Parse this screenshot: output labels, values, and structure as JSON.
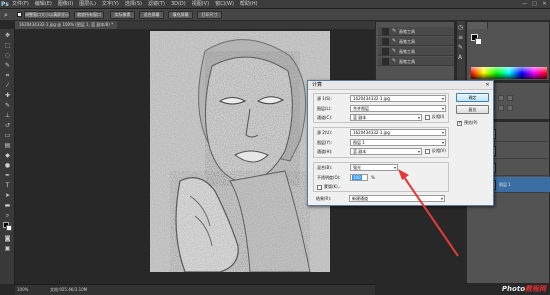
{
  "app": {
    "logo": "Ps"
  },
  "menu": [
    "文件(F)",
    "编辑(E)",
    "图像(I)",
    "图层(L)",
    "文字(Y)",
    "选择(S)",
    "滤镜(T)",
    "3D(D)",
    "视图(V)",
    "窗口(W)",
    "帮助(H)"
  ],
  "window_controls": [
    "—",
    "□",
    "✕"
  ],
  "options": {
    "buttons": [
      "调整窗口大小以满屏显示",
      "缩放所有窗口",
      "实际像素",
      "适合屏幕",
      "填充屏幕",
      "打印尺寸"
    ]
  },
  "document": {
    "tab": "1620434332-1.jpg @ 100% (图层 1, 蓝 副本/8) *",
    "zoom": "100%",
    "doc_info": "文档:925.4K/3.10M"
  },
  "history": {
    "items": [
      "画笔工具",
      "画笔工具",
      "画笔工具",
      "画笔工具"
    ]
  },
  "layers": {
    "items": [
      "图层 1",
      "",
      "",
      ""
    ]
  },
  "dialog": {
    "title": "计算",
    "source1": {
      "source_label": "源 1(S):",
      "source_value": "1620434332-1.jpg",
      "layer_label": "图层(L):",
      "layer_value": "合并图层",
      "channel_label": "通道(C):",
      "channel_value": "蓝 副本",
      "invert_label": "反相(I)"
    },
    "source2": {
      "source_label": "源 2(U):",
      "source_value": "1620434332-1.jpg",
      "layer_label": "图层(Y):",
      "layer_value": "图层 1",
      "channel_label": "通道(H):",
      "channel_value": "蓝 副本",
      "invert_label": "反相(V)"
    },
    "blend": {
      "blend_label": "混合(B):",
      "blend_value": "强光",
      "opacity_label": "不透明度(O):",
      "opacity_value": "100",
      "opacity_unit": "%",
      "mask_label": "蒙版(K)..."
    },
    "result": {
      "result_label": "结果(R):",
      "result_value": "新建通道"
    },
    "ok_label": "确定",
    "reset_label": "复位",
    "preview_label": "预览(P)",
    "preview_checked": true
  },
  "watermark": {
    "left": "Photo",
    "right": "教程网"
  },
  "colors": {
    "accent": "#3a6ea5",
    "arrow": "#e23b3b"
  }
}
